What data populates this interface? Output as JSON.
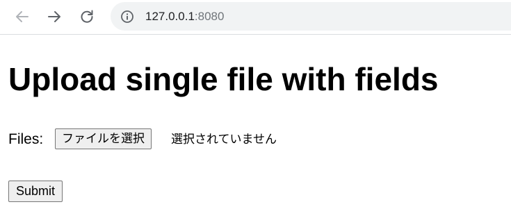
{
  "browser": {
    "url_host": "127.0.0.1",
    "url_port": ":8080",
    "icons": {
      "back": "arrow-left-icon",
      "forward": "arrow-right-icon",
      "reload": "reload-icon",
      "site_info": "info-icon"
    },
    "colors": {
      "toolbar_bg": "#ffffff",
      "omnibox_bg": "#f1f3f4",
      "back_disabled": "#b0b3b8",
      "icon": "#5f6368"
    }
  },
  "page": {
    "heading": "Upload single file with fields",
    "files_label": "Files:",
    "file_button_label": "ファイルを選択",
    "file_status": "選択されていません",
    "submit_label": "Submit"
  }
}
